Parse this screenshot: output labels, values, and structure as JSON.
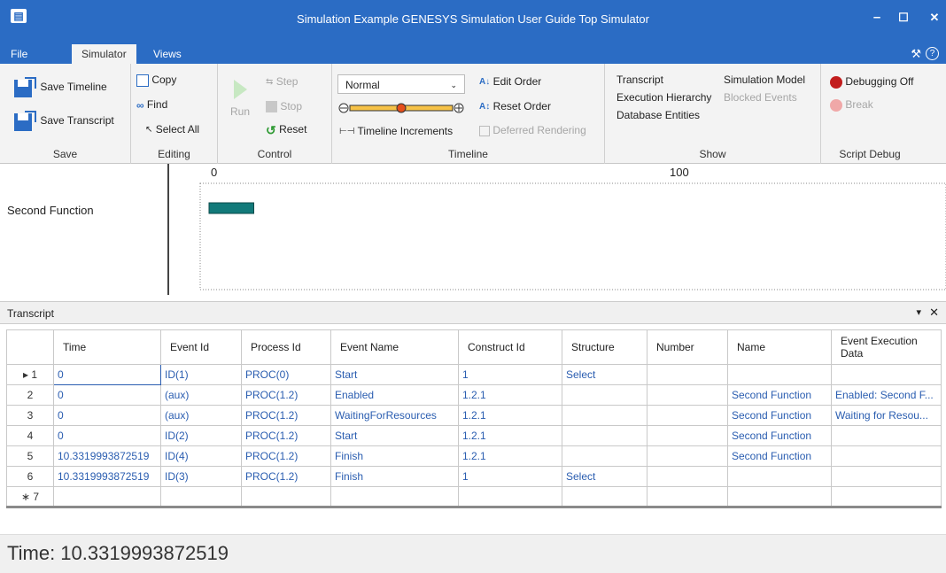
{
  "window": {
    "title": "Simulation Example GENESYS Simulation User Guide Top Simulator",
    "minimize": "–",
    "maximize": "☐",
    "close": "✕"
  },
  "menu": {
    "tabs": [
      {
        "label": "File"
      },
      {
        "label": "Simulator"
      },
      {
        "label": "Views"
      }
    ],
    "active": "Simulator"
  },
  "ribbon": {
    "save": {
      "label": "Save",
      "save_timeline": "Save Timeline",
      "save_transcript": "Save Transcript"
    },
    "editing": {
      "label": "Editing",
      "copy": "Copy",
      "find": "Find",
      "select_all": "Select All"
    },
    "control": {
      "label": "Control",
      "run": "Run",
      "step": "Step",
      "stop": "Stop",
      "reset": "Reset"
    },
    "timeline": {
      "label": "Timeline",
      "speed_value": "Normal",
      "slider_position": 0.5,
      "timeline_increments": "Timeline Increments",
      "edit_order": "Edit Order",
      "reset_order": "Reset Order",
      "deferred_rendering": "Deferred Rendering"
    },
    "show": {
      "label": "Show",
      "transcript": "Transcript",
      "execution_hierarchy": "Execution Hierarchy",
      "database_entities": "Database Entities",
      "simulation_model": "Simulation Model",
      "blocked_events": "Blocked Events"
    },
    "script_debug": {
      "label": "Script Debug",
      "debugging_off": "Debugging Off",
      "break": "Break"
    }
  },
  "timeline_view": {
    "function_label": "Second Function",
    "tick_0": "0",
    "tick_100": "100",
    "bar_start": 0,
    "bar_end": 10.3319993872519,
    "axis_max": 148,
    "bar_color": "#127a7a"
  },
  "transcript": {
    "title": "Transcript",
    "pin": "▾",
    "close": "✕",
    "columns": [
      "Time",
      "Event Id",
      "Process Id",
      "Event Name",
      "Construct Id",
      "Structure",
      "Number",
      "Name",
      "Event Execution Data"
    ],
    "rows": [
      {
        "rowhead": "▸ 1",
        "time": "0",
        "event_id": "ID(1)",
        "process_id": "PROC(0)",
        "event_name": "Start",
        "construct_id": "1",
        "structure": "Select",
        "number": "",
        "name": "",
        "exec": ""
      },
      {
        "rowhead": "2",
        "time": "0",
        "event_id": "(aux)",
        "process_id": "PROC(1.2)",
        "event_name": "Enabled",
        "construct_id": "1.2.1",
        "structure": "",
        "number": "",
        "name": "Second Function",
        "exec": "Enabled: Second F..."
      },
      {
        "rowhead": "3",
        "time": "0",
        "event_id": "(aux)",
        "process_id": "PROC(1.2)",
        "event_name": "WaitingForResources",
        "construct_id": "1.2.1",
        "structure": "",
        "number": "",
        "name": "Second Function",
        "exec": "Waiting for Resou..."
      },
      {
        "rowhead": "4",
        "time": "0",
        "event_id": "ID(2)",
        "process_id": "PROC(1.2)",
        "event_name": "Start",
        "construct_id": "1.2.1",
        "structure": "",
        "number": "",
        "name": "Second Function",
        "exec": ""
      },
      {
        "rowhead": "5",
        "time": "10.3319993872519",
        "event_id": "ID(4)",
        "process_id": "PROC(1.2)",
        "event_name": "Finish",
        "construct_id": "1.2.1",
        "structure": "",
        "number": "",
        "name": "Second Function",
        "exec": ""
      },
      {
        "rowhead": "6",
        "time": "10.3319993872519",
        "event_id": "ID(3)",
        "process_id": "PROC(1.2)",
        "event_name": "Finish",
        "construct_id": "1",
        "structure": "Select",
        "number": "",
        "name": "",
        "exec": ""
      },
      {
        "rowhead": "∗ 7",
        "time": "",
        "event_id": "",
        "process_id": "",
        "event_name": "",
        "construct_id": "",
        "structure": "",
        "number": "",
        "name": "",
        "exec": ""
      }
    ]
  },
  "status": {
    "text": "Time: 10.3319993872519"
  }
}
